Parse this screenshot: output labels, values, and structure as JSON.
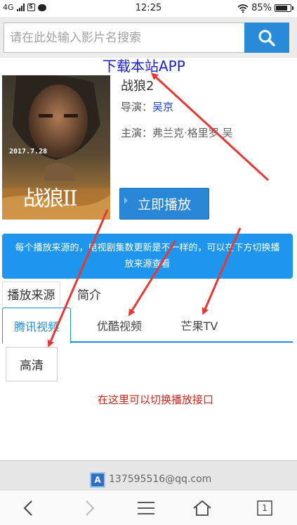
{
  "status_bar": {
    "network": "4G",
    "sim_icon": "S",
    "time": "12:25",
    "battery_percent": "85%",
    "battery_level": 0.85,
    "icons": [
      "signal-icon",
      "sim-icon",
      "message-icon",
      "wifi-icon",
      "battery-icon"
    ]
  },
  "search": {
    "placeholder": "请在此处输入影片名搜索",
    "button_icon": "search-icon"
  },
  "app_download_link": "下载本站APP",
  "movie": {
    "title": "战狼2",
    "director_label": "导演：",
    "director": "吴京",
    "cast_label": "主演：",
    "cast": "弗兰克·格里罗 吴",
    "poster": {
      "date_text": "2017.7.28",
      "title_text": "战狼II"
    },
    "play_button": "立即播放"
  },
  "notice": "每个播放来源的，电视剧集数更新是不一样的，可以在下方切换播放来源查看",
  "sub_tabs": [
    {
      "label": "播放来源",
      "active": true
    },
    {
      "label": "简介",
      "active": false
    }
  ],
  "source_tabs": [
    {
      "label": "腾讯视频",
      "active": true
    },
    {
      "label": "优酷视频",
      "active": false
    },
    {
      "label": "芒果TV",
      "active": false
    }
  ],
  "episode_button": "高清",
  "hint_text": "在这里可以切换播放接口",
  "footer": {
    "icon_letter": "A",
    "email": "137595516@qq.com"
  },
  "browser_nav": {
    "tabs_count": "1",
    "icons": [
      "back-icon",
      "forward-icon",
      "menu-icon",
      "home-icon",
      "tabs-icon"
    ]
  },
  "colors": {
    "accent": "#2a8bd8",
    "notice_bg": "#1e96ee",
    "link": "#1a22cc",
    "hint": "#d4241c",
    "annotation_arrow": "#e53935"
  }
}
